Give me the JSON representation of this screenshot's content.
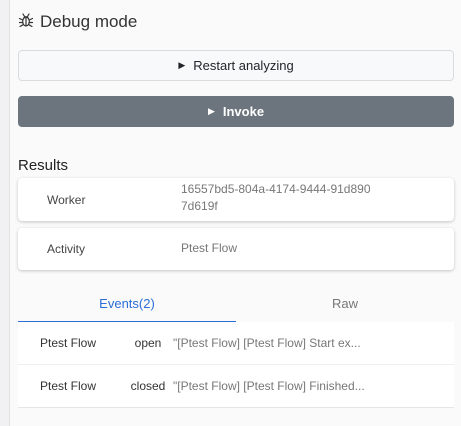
{
  "header": {
    "title": "Debug mode",
    "icon": "bug-icon"
  },
  "buttons": {
    "restart": {
      "label": "Restart analyzing",
      "icon": "play-triangle-icon"
    },
    "invoke": {
      "label": "Invoke",
      "icon": "play-triangle-icon"
    }
  },
  "results": {
    "title": "Results",
    "worker": {
      "key": "Worker",
      "value": "16557bd5-804a-4174-9444-91d8907d619f"
    },
    "activity": {
      "key": "Activity",
      "value": "Ptest Flow"
    }
  },
  "tabs": [
    {
      "label": "Events(2)",
      "active": true
    },
    {
      "label": "Raw",
      "active": false
    }
  ],
  "events": [
    {
      "name": "Ptest Flow",
      "state": "open",
      "message": "\"[Ptest Flow] [Ptest Flow] Start ex..."
    },
    {
      "name": "Ptest Flow",
      "state": "closed",
      "message": "\"[Ptest Flow] [Ptest Flow] Finished..."
    }
  ],
  "colors": {
    "accent": "#2b6fd6",
    "invoke_bg": "#6c757d"
  }
}
